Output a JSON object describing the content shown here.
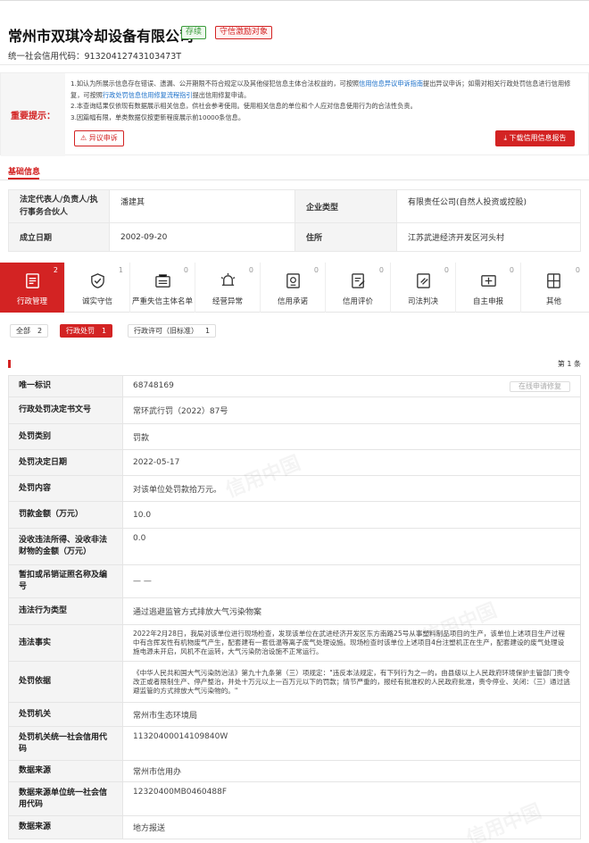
{
  "header": {
    "company_name": "常州市双琪冷却设备有限公司",
    "badge_status": "存续",
    "badge_incentive": "守信激励对象",
    "credit_code": "统一社会信用代码：91320412743103473T"
  },
  "notice": {
    "label": "重要提示：",
    "line1_a": "1.如认为所展示信息存在错误、遗漏、公开期限不符合规定以及其他侵犯信息主体合法权益的，可按照",
    "line1_link": "信用信息异议申诉指南",
    "line1_b": "提出异议申诉；如需对相关行政处罚信息进行信用修复，可按照",
    "line1_link2": "行政处罚信息信用修复流程指引",
    "line1_c": "提出信用修复申请。",
    "line2": "2.本查询结果仅依现有数据展示相关信息，供社会参考使用。使用相关信息的单位和个人应对信息使用行为的合法性负责。",
    "line3": "3.因篇幅有限，单类数据仅按更新程度展示前10000条信息。",
    "appeal_button": "异议申诉",
    "download_button": "下载信用信息报告"
  },
  "basic": {
    "title": "基础信息",
    "legal_rep_label": "法定代表人/负责人/执行事务合伙人",
    "legal_rep_value": "潘建其",
    "company_type_label": "企业类型",
    "company_type_value": "有限责任公司(自然人投资或控股)",
    "established_label": "成立日期",
    "established_value": "2002-09-20",
    "address_label": "住所",
    "address_value": "江苏武进经济开发区河头村"
  },
  "tabs": [
    {
      "label": "行政管理",
      "count": "2",
      "icon": "admin-icon"
    },
    {
      "label": "诚实守信",
      "count": "1",
      "icon": "honesty-icon"
    },
    {
      "label": "严重失信主体名单",
      "count": "0",
      "icon": "blacklist-icon"
    },
    {
      "label": "经营异常",
      "count": "0",
      "icon": "alarm-icon"
    },
    {
      "label": "信用承诺",
      "count": "0",
      "icon": "commitment-icon"
    },
    {
      "label": "信用评价",
      "count": "0",
      "icon": "evaluation-icon"
    },
    {
      "label": "司法判决",
      "count": "0",
      "icon": "judgement-icon"
    },
    {
      "label": "自主申报",
      "count": "0",
      "icon": "declare-icon"
    },
    {
      "label": "其他",
      "count": "0",
      "icon": "other-icon"
    }
  ],
  "filters": [
    {
      "label": "全部",
      "count": "2"
    },
    {
      "label": "行政处罚",
      "count": "1"
    },
    {
      "label": "行政许可（旧标准）",
      "count": "1"
    }
  ],
  "record_count": "第 1 条",
  "repair_button": "在线申请修复",
  "watermark": "信用中国",
  "detail": [
    {
      "label": "唯一标识",
      "value": "68748169"
    },
    {
      "label": "行政处罚决定书文号",
      "value": "常环武行罚（2022）87号"
    },
    {
      "label": "处罚类别",
      "value": "罚款"
    },
    {
      "label": "处罚决定日期",
      "value": "2022-05-17"
    },
    {
      "label": "处罚内容",
      "value": "对该单位处罚款拾万元。"
    },
    {
      "label": "罚款金额（万元）",
      "value": "10.0"
    },
    {
      "label": "没收违法所得、没收非法财物的金额（万元）",
      "value": "0.0"
    },
    {
      "label": "暂扣或吊销证照名称及编号",
      "value": "— —"
    },
    {
      "label": "违法行为类型",
      "value": "通过逃避监管方式排放大气污染物案"
    },
    {
      "label": "违法事实",
      "value": "2022年2月28日，我局对该单位进行现场检查，发现该单位在武进经济开发区东方南路25号从事塑料制品项目的生产，该单位上述项目生产过程中有含挥发性有机物废气产生，配套建有一套低温等离子废气处理设施。现场检查时该单位上述项目4台注塑机正在生产，配套建设的废气处理设施电源未开启，风机不在运转，大气污染防治设施不正常运行。"
    },
    {
      "label": "处罚依据",
      "value": "《中华人民共和国大气污染防治法》第九十九条第（三）项规定：\"违反本法规定，有下列行为之一的，由县级以上人民政府环境保护主管部门责令改正或者限制生产、停产整治，并处十万元以上一百万元以下的罚款；情节严重的，报经有批准权的人民政府批准，责令停业、关闭：（三）通过逃避监管的方式排放大气污染物的。\""
    },
    {
      "label": "处罚机关",
      "value": "常州市生态环境局"
    },
    {
      "label": "处罚机关统一社会信用代码",
      "value": "11320400014109840W"
    },
    {
      "label": "数据来源",
      "value": "常州市信用办"
    },
    {
      "label": "数据来源单位统一社会信用代码",
      "value": "12320400MB0460488F"
    },
    {
      "label": "数据来源",
      "value": "地方报送"
    }
  ],
  "colors": {
    "accent": "#d32323",
    "status_green": "#3a9b3a",
    "link": "#1a6fc9"
  }
}
